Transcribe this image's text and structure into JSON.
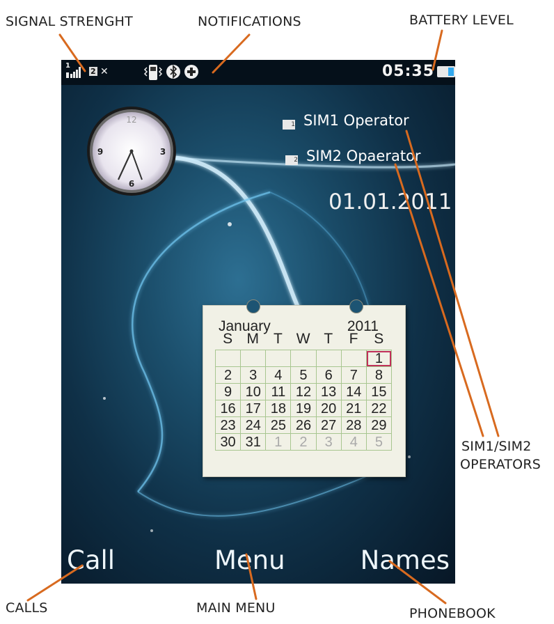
{
  "annotations": {
    "signal_strength": "SIGNAL STRENGHT",
    "notifications": "NOTIFICATIONS",
    "battery_level": "BATTERY LEVEL",
    "sim_operators_line1": "SIM1/SIM2",
    "sim_operators_line2": "OPERATORS",
    "calls": "CALLS",
    "main_menu": "MAIN MENU",
    "phonebook": "PHONEBOOK"
  },
  "status_bar": {
    "sim_indicator": "1",
    "network": "2",
    "time": "05:35",
    "battery_percent": 35
  },
  "clock": {
    "numerals": [
      "12",
      "3",
      "6",
      "9"
    ]
  },
  "operators": {
    "sim1": "SIM1 Operator",
    "sim2": "SIM2 Opaerator"
  },
  "date": "01.01.2011",
  "calendar": {
    "month": "January",
    "year": "2011",
    "weekdays": [
      "S",
      "M",
      "T",
      "W",
      "T",
      "F",
      "S"
    ],
    "weeks": [
      [
        "",
        "",
        "",
        "",
        "",
        "",
        "1"
      ],
      [
        "2",
        "3",
        "4",
        "5",
        "6",
        "7",
        "8"
      ],
      [
        "9",
        "10",
        "11",
        "12",
        "13",
        "14",
        "15"
      ],
      [
        "16",
        "17",
        "18",
        "19",
        "20",
        "21",
        "22"
      ],
      [
        "23",
        "24",
        "25",
        "26",
        "27",
        "28",
        "29"
      ],
      [
        "30",
        "31",
        "1",
        "2",
        "3",
        "4",
        "5"
      ]
    ],
    "today": "1",
    "today_color": "#c0305a",
    "grid_color": "#a8c690"
  },
  "softkeys": {
    "left": "Call",
    "center": "Menu",
    "right": "Names"
  },
  "colors": {
    "annotation_line": "#d86a1f",
    "battery_fill": "#33a9ee"
  },
  "icons": [
    "signal-icon",
    "vibrate-phone-icon",
    "bluetooth-icon",
    "plus-circle-icon",
    "battery-icon",
    "sim1-card-icon",
    "sim2-card-icon"
  ]
}
